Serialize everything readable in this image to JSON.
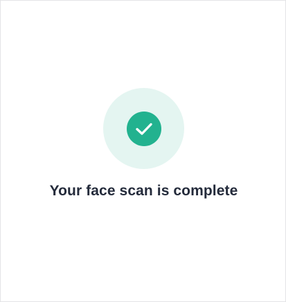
{
  "status": {
    "title": "Your face scan is complete",
    "icon": "checkmark-icon",
    "icon_color": "#22b28f",
    "halo_color": "#e4f5f1"
  }
}
